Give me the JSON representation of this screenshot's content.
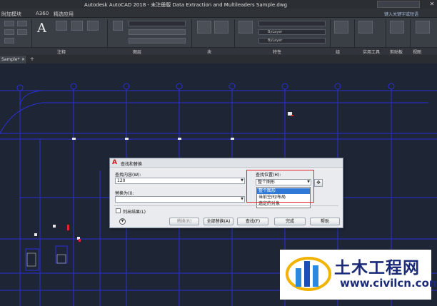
{
  "window": {
    "title": "Autodesk AutoCAD 2018 - 未注册版    Data Extraction and Multileaders Sample.dwg",
    "search_placeholder": "键入关键字或短语",
    "close_glyph": "✕"
  },
  "menu": {
    "items": [
      "附加模块",
      "A360",
      "精选应用"
    ]
  },
  "ribbon": {
    "panels": [
      "注释",
      "图层",
      "块",
      "特性",
      "组",
      "实用工具",
      "剪贴板",
      "视图"
    ],
    "bylayer_1": "ByLayer",
    "bylayer_2": "ByLayer"
  },
  "file_tab": {
    "label": "Sample*",
    "close_glyph": "✕",
    "new_tab_glyph": "+"
  },
  "dialog": {
    "title": "查找和替换",
    "find_label": "查找内容(W):",
    "find_value": "120",
    "replace_label": "替换为(I):",
    "replace_value": "",
    "location_label": "查找位置(H):",
    "location_selected": "整个图形",
    "location_options": [
      "整个图形",
      "当前空间/布局",
      "选定的对象"
    ],
    "list_results_label": "列出结果(L)",
    "buttons": {
      "replace": "替换(R)",
      "replace_all": "全部替换(A)",
      "find": "查找(F)",
      "done": "完成",
      "help": "帮助"
    }
  },
  "watermark": {
    "title": "土木工程网",
    "url": "www.civilcn.com"
  },
  "colors": {
    "canvas_bg": "#1e2534",
    "line_blue": "#2a2fd8",
    "highlight_red": "#e0262a",
    "select_blue": "#3079d6"
  }
}
